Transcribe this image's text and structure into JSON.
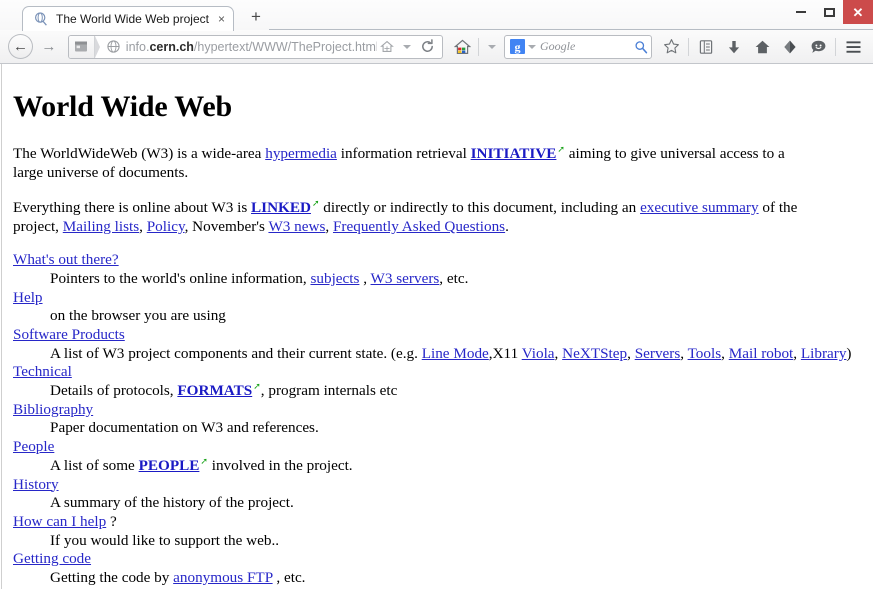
{
  "window": {
    "minimize_label": "Minimize",
    "maximize_label": "Maximize",
    "close_label": "Close"
  },
  "tabs": [
    {
      "title": "The World Wide Web project",
      "favicon": "cern-globe-icon",
      "close_glyph": "×"
    }
  ],
  "newtab": {
    "glyph": "+"
  },
  "navbar": {
    "back_glyph": "←",
    "forward_glyph": "→",
    "url_prefix": "info.",
    "url_domain": "cern.ch",
    "url_path": "/hypertext/WWW/TheProject.html",
    "identity_icon": "site-identity-icon",
    "globe_icon": "globe-icon",
    "bookmark_home_icon": "home-small-icon",
    "reload_glyph": "⟳",
    "home_icon": "colored-home-icon",
    "dropdown_glyph": "▾"
  },
  "search": {
    "engine_badge": "g",
    "engine_name": "Google",
    "placeholder": "Google",
    "magnifier_icon": "search-icon"
  },
  "toolbar_icons": [
    {
      "name": "star-icon",
      "glyph": "☆"
    },
    {
      "name": "reading-list-icon",
      "glyph": "▤"
    },
    {
      "name": "download-icon",
      "glyph": "⬇"
    },
    {
      "name": "home-icon",
      "glyph": "⌂"
    },
    {
      "name": "sync-icon",
      "glyph": "⬧"
    },
    {
      "name": "chat-icon",
      "glyph": "☺"
    },
    {
      "name": "menu-icon",
      "glyph": "≡"
    }
  ],
  "page": {
    "title": "World Wide Web",
    "paragraph1": {
      "t1": "The WorldWideWeb (W3) is a wide-area",
      "link_hypermedia": "hypermedia",
      "t2": "information retrieval",
      "link_initiative": "INITIATIVE",
      "t3": "aiming to give universal access to a large universe of documents."
    },
    "paragraph2": {
      "t1": "Everything there is online about W3 is",
      "link_linked": "LINKED",
      "t2": "directly or indirectly to this document, including an",
      "link_exec": "executive summary",
      "t3": "of the project,",
      "link_mailing": "Mailing lists",
      "t4": ",",
      "link_policy": "Policy",
      "t5": ", November's",
      "link_w3news": "W3 news",
      "t6": ",",
      "link_faq": "Frequently Asked Questions",
      "t7": "."
    },
    "entries": [
      {
        "term": "What's out there?",
        "def_t1": "Pointers to the world's online information,",
        "def_link1": "subjects",
        "def_t2": ",",
        "def_link2": "W3 servers",
        "def_t3": ", etc."
      },
      {
        "term": "Help",
        "def_t1": "on the browser you are using"
      },
      {
        "term": "Software Products",
        "def_t1": "A list of W3 project components and their current state. (e.g.",
        "def_link1": "Line Mode",
        "def_t2": ",X11",
        "def_link2": "Viola",
        "def_t3": ",",
        "def_link3": "NeXTStep",
        "def_t4": ",",
        "def_link4": "Servers",
        "def_t5": ",",
        "def_link5": "Tools",
        "def_t6": ",",
        "def_link6": "Mail robot",
        "def_t7": ",",
        "def_link7": "Library",
        "def_t8": ")"
      },
      {
        "term": "Technical",
        "def_t1": "Details of protocols,",
        "def_link1": "FORMATS",
        "def_t2": ", program internals etc"
      },
      {
        "term": "Bibliography",
        "def_t1": "Paper documentation on W3 and references."
      },
      {
        "term": "People",
        "def_t1": "A list of some",
        "def_link1": "PEOPLE",
        "def_t2": "involved in the project."
      },
      {
        "term": "History",
        "def_t1": "A summary of the history of the project."
      },
      {
        "term": "How can I help",
        "term_suffix": "?",
        "def_t1": "If you would like to support the web.."
      },
      {
        "term": "Getting code",
        "def_t1": "Getting the code by",
        "def_link1": "anonymous FTP",
        "def_t2": ", etc."
      }
    ],
    "external_link_glyph": "↗"
  },
  "colors": {
    "link": "#2727c8",
    "external_icon": "#19a319",
    "close_button": "#cc4b4b",
    "google_blue": "#4184f3"
  }
}
